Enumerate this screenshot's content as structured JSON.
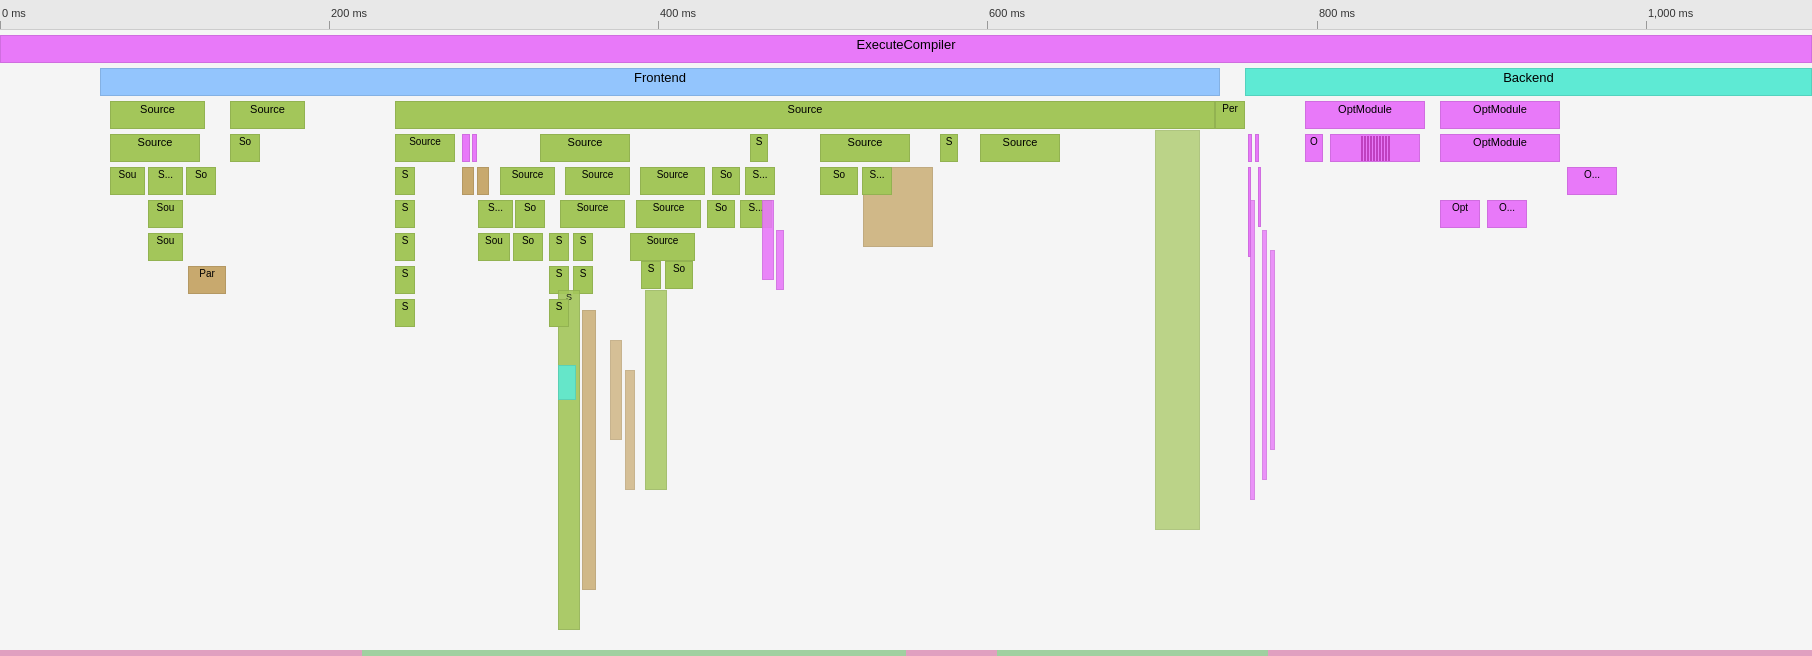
{
  "ruler": {
    "ticks": [
      {
        "label": "0 ms",
        "left_pct": 0
      },
      {
        "label": "200 ms",
        "left_pct": 18.18
      },
      {
        "label": "400 ms",
        "left_pct": 36.36
      },
      {
        "label": "600 ms",
        "left_pct": 54.55
      },
      {
        "label": "800 ms",
        "left_pct": 72.73
      },
      {
        "label": "1,000 ms",
        "left_pct": 90.91
      }
    ]
  },
  "blocks": {
    "execute_compiler": {
      "label": "ExecuteCompiler",
      "color": "#e879f9"
    },
    "frontend": {
      "label": "Frontend",
      "color": "#93c5fd"
    },
    "backend": {
      "label": "Backend",
      "color": "#5eead4"
    },
    "source": {
      "label": "Source",
      "color": "#a3c65a"
    },
    "source_short": {
      "label": "S",
      "color": "#a3c65a"
    },
    "source_sou": {
      "label": "Sou",
      "color": "#a3c65a"
    },
    "source_so": {
      "label": "So",
      "color": "#a3c65a"
    },
    "source_sdot": {
      "label": "S...",
      "color": "#a3c65a"
    },
    "par": {
      "label": "Par",
      "color": "#c8a96e"
    },
    "per": {
      "label": "Per",
      "color": "#a3c65a"
    },
    "optmodule": {
      "label": "OptModule",
      "color": "#e879f9"
    },
    "opt_short": {
      "label": "O",
      "color": "#e879f9"
    },
    "opt_o_dot": {
      "label": "O...",
      "color": "#e879f9"
    },
    "opt_opt": {
      "label": "Opt",
      "color": "#e879f9"
    },
    "teal_block": {
      "label": "",
      "color": "#5eead4"
    }
  }
}
